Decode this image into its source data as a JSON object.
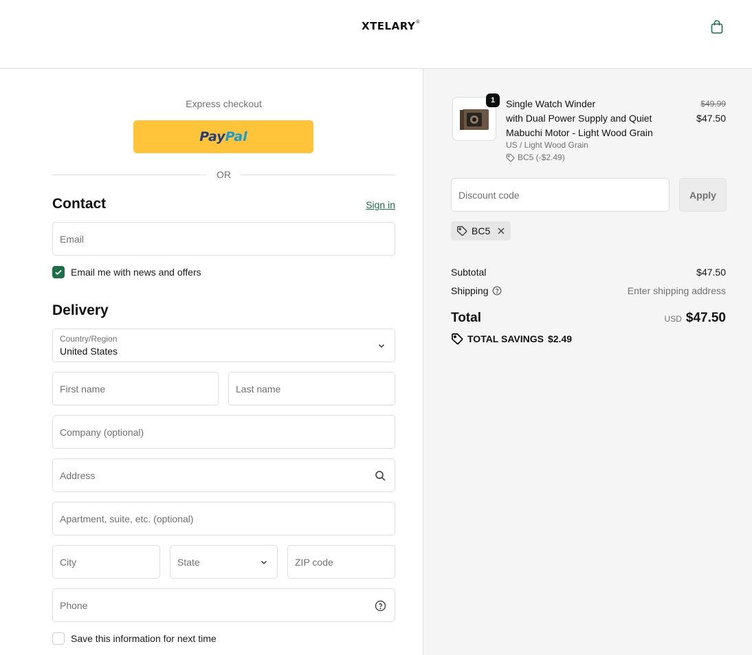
{
  "header": {
    "logo": "XTELARY",
    "logo_mark": "®",
    "cart_icon": "shopping-bag-icon"
  },
  "express": {
    "label": "Express checkout",
    "paypal_a": "Pay",
    "paypal_b": "Pal",
    "or_text": "OR"
  },
  "contact": {
    "title": "Contact",
    "signin_label": "Sign in",
    "email_placeholder": "Email",
    "newsletter_label": "Email me with news and offers",
    "newsletter_checked": true
  },
  "delivery": {
    "title": "Delivery",
    "country_label": "Country/Region",
    "country_value": "United States",
    "first_name": "First name",
    "last_name": "Last name",
    "company": "Company (optional)",
    "address": "Address",
    "apartment": "Apartment, suite, etc. (optional)",
    "city": "City",
    "state": "State",
    "zip": "ZIP code",
    "phone": "Phone",
    "save_info_label": "Save this information for next time",
    "save_info_checked": false
  },
  "summary": {
    "product": {
      "quantity": "1",
      "name_line1": "Single Watch Winder",
      "name_line2": "with Dual Power Supply and Quiet",
      "name_line3": "Mabuchi Motor - Light Wood Grain",
      "variant": "US / Light Wood Grain",
      "discount": "BC5 (-$2.49)",
      "original_price": "$49.99",
      "price": "$47.50"
    },
    "discount_placeholder": "Discount code",
    "apply_label": "Apply",
    "applied_code": "BC5",
    "subtotal_label": "Subtotal",
    "subtotal_value": "$47.50",
    "shipping_label": "Shipping",
    "shipping_value": "Enter shipping address",
    "total_label": "Total",
    "total_currency": "USD",
    "total_value": "$47.50",
    "savings_label": "TOTAL SAVINGS",
    "savings_value": "$2.49"
  },
  "colors": {
    "accent": "#1f6e4a",
    "paypal_yellow": "#ffc439",
    "paypal_dark_blue": "#253b80",
    "paypal_light_blue": "#179bd7"
  }
}
